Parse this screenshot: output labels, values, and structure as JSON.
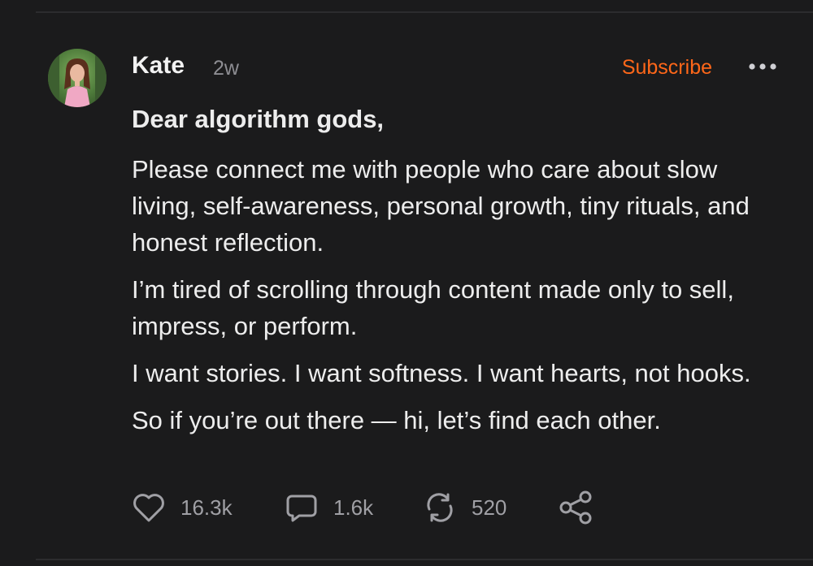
{
  "post": {
    "author": "Kate",
    "time": "2w",
    "subscribe_label": "Subscribe",
    "greeting": "Dear algorithm gods,",
    "paragraphs": [
      "Please connect me with people who care about slow living, self-awareness, personal growth, tiny rituals, and honest reflection.",
      "I’m tired of scrolling through content made only to sell, impress, or perform.",
      "I want stories. I want softness. I want hearts, not hooks.",
      "So if you’re out there — hi, let’s find each other."
    ],
    "actions": {
      "likes": "16.3k",
      "comments": "1.6k",
      "restacks": "520"
    }
  },
  "colors": {
    "background": "#1b1b1c",
    "accent": "#ff6719",
    "muted": "#8e8e93",
    "text": "#ededed"
  },
  "icons": [
    "heart-icon",
    "comment-icon",
    "restack-icon",
    "share-icon",
    "more-icon"
  ]
}
